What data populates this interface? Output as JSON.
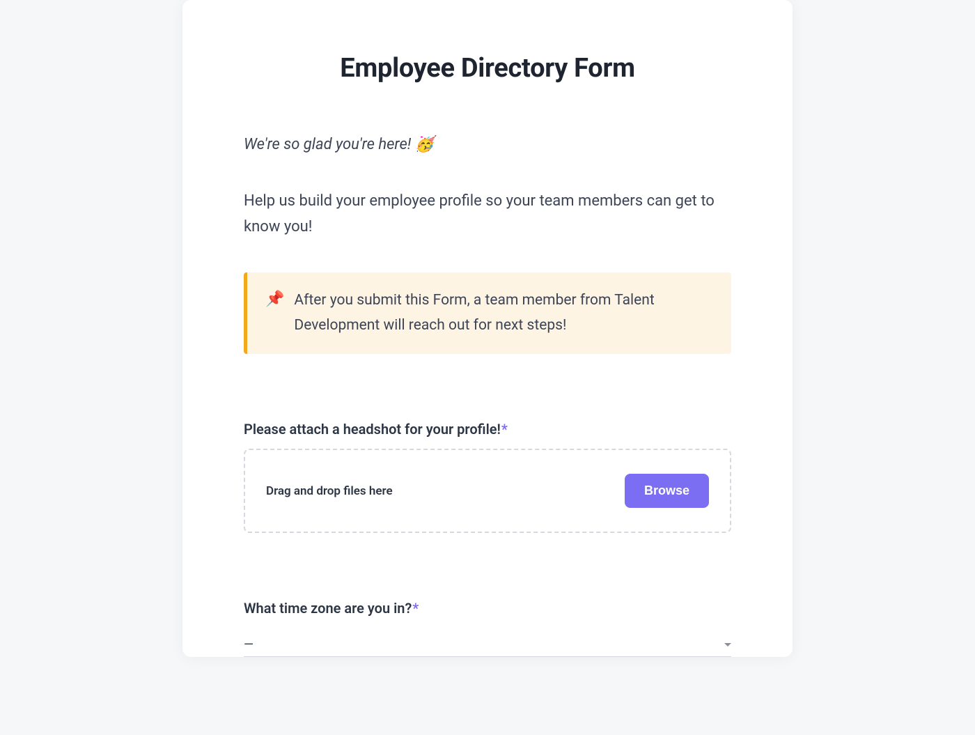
{
  "form": {
    "title": "Employee Directory Form",
    "welcome": "We're so glad you're here! 🥳",
    "description": "Help us build your employee profile so your team members can get to know you!",
    "callout": {
      "icon": "📌",
      "text": "After you submit this Form, a team member from Talent Development will reach out for next steps!"
    },
    "fields": {
      "headshot": {
        "label": "Please attach a headshot for your profile!",
        "required_marker": "*",
        "dropzone_text": "Drag and drop files here",
        "browse_label": "Browse"
      },
      "timezone": {
        "label": "What time zone are you in?",
        "required_marker": "*",
        "value": "—"
      }
    }
  },
  "colors": {
    "accent": "#7c6ef2",
    "callout_bg": "#fdf4e4",
    "callout_border": "#f4a81c"
  }
}
